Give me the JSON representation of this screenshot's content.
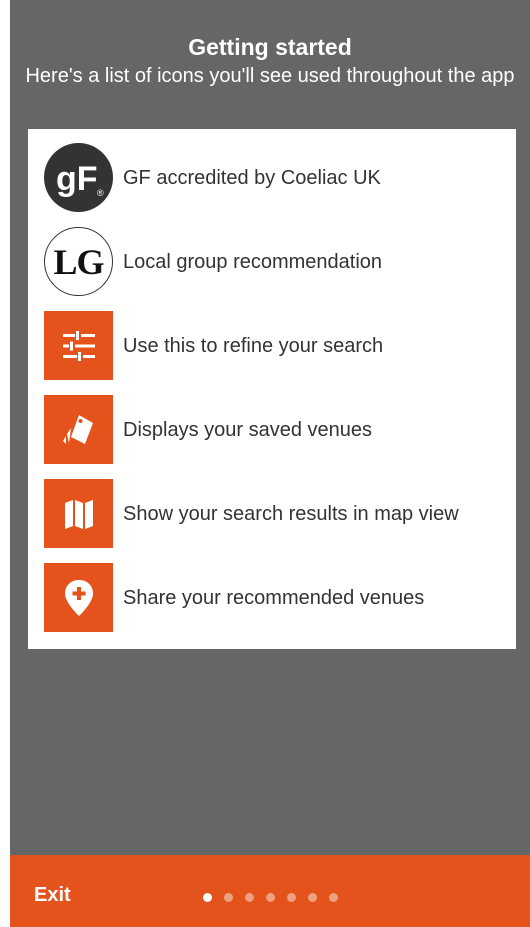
{
  "header": {
    "title": "Getting started",
    "subtitle": "Here's a list of icons you'll see used throughout the app"
  },
  "legend": [
    {
      "icon": "gf-accredited-icon",
      "label": "GF accredited by Coeliac UK"
    },
    {
      "icon": "local-group-icon",
      "icon_text": "LG",
      "label": "Local group recommendation"
    },
    {
      "icon": "filter-sliders-icon",
      "label": "Use this to refine your search"
    },
    {
      "icon": "saved-venues-icon",
      "label": "Displays your saved venues"
    },
    {
      "icon": "map-view-icon",
      "label": "Show your search results in map view"
    },
    {
      "icon": "add-location-pin-icon",
      "label": "Share your recommended venues"
    }
  ],
  "footer": {
    "exit_label": "Exit",
    "page_count": 7,
    "current_page": 1
  },
  "colors": {
    "accent": "#e4531c",
    "background": "#666666",
    "card": "#ffffff"
  }
}
